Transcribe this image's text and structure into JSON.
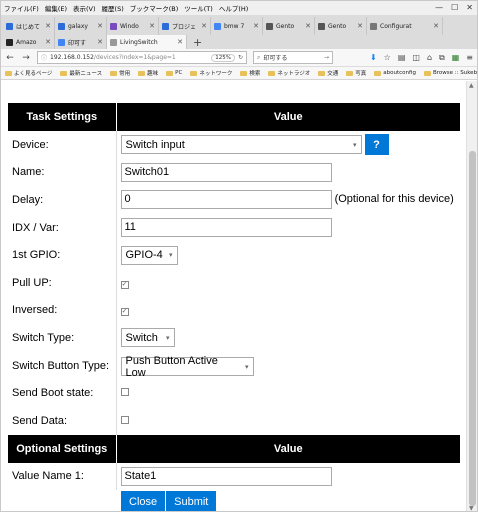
{
  "menu": [
    "ファイル(F)",
    "編集(E)",
    "表示(V)",
    "履歴(S)",
    "ブックマーク(B)",
    "ツール(T)",
    "ヘルプ(H)"
  ],
  "tabs_row1": [
    {
      "label": "はじめて",
      "color": "#2b6cd9"
    },
    {
      "label": "galaxy",
      "color": "#2b6cd9"
    },
    {
      "label": "Windo",
      "color": "#7a4ac0"
    },
    {
      "label": "プロジェ",
      "color": "#2b6cd9"
    },
    {
      "label": "bmw 7",
      "color": "#4285f4"
    },
    {
      "label": "Gento",
      "color": "#555555"
    },
    {
      "label": "Gento",
      "color": "#555555"
    },
    {
      "label": "Configurat",
      "color": "#777777"
    }
  ],
  "tabs_row2": [
    {
      "label": "Amazo",
      "color": "#222222"
    },
    {
      "label": "印可す",
      "color": "#4285f4"
    },
    {
      "label": "LivingSwitch",
      "color": "#999999"
    }
  ],
  "nav": {
    "url_host": "192.168.0.152",
    "url_path": "/devices?index=1&page=1",
    "zoom": "125%",
    "search_text": "印可する"
  },
  "bookmarks": [
    "よく見るページ",
    "最新ニュース",
    "常用",
    "趣味",
    "PC",
    "ネットワーク",
    "検索",
    "ネットラジオ",
    "交通",
    "写真",
    "aboutconfig",
    "Browse :: Sukebei"
  ],
  "table": {
    "header_task": "Task Settings",
    "header_value": "Value",
    "rows": {
      "device": {
        "label": "Device:",
        "value": "Switch input",
        "help": "?"
      },
      "name": {
        "label": "Name:",
        "value": "Switch01"
      },
      "delay": {
        "label": "Delay:",
        "value": "0",
        "note": "(Optional for this device)"
      },
      "idx": {
        "label": "IDX / Var:",
        "value": "11"
      },
      "gpio": {
        "label": "1st GPIO:",
        "value": "GPIO-4"
      },
      "pullup": {
        "label": "Pull UP:",
        "checked": true
      },
      "inversed": {
        "label": "Inversed:",
        "checked": true
      },
      "switch_type": {
        "label": "Switch Type:",
        "value": "Switch"
      },
      "switch_button_type": {
        "label": "Switch Button Type:",
        "value": "Push Button Active Low"
      },
      "send_boot": {
        "label": "Send Boot state:",
        "checked": false
      },
      "send_data": {
        "label": "Send Data:",
        "checked": false
      }
    },
    "header_optional": "Optional Settings",
    "header_value2": "Value",
    "value_name_1": {
      "label": "Value Name 1:",
      "value": "State1"
    }
  },
  "buttons": {
    "close": "Close",
    "submit": "Submit"
  },
  "check_glyph": "☑"
}
